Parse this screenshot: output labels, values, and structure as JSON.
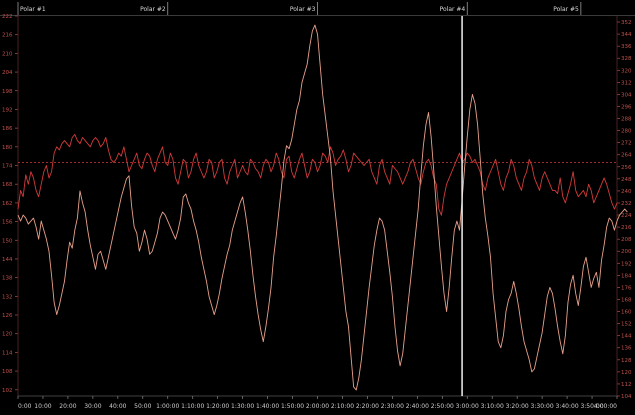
{
  "laps": [
    {
      "label": "Polar #1",
      "start_index": 0
    },
    {
      "label": "Polar #2",
      "start_index": 58
    },
    {
      "label": "Polar #3",
      "start_index": 116
    },
    {
      "label": "Polar #4",
      "start_index": 174
    },
    {
      "label": "Polar #5",
      "start_index": 218
    }
  ],
  "cursor": {
    "x_label": "2:50:00",
    "index": 172
  },
  "chart_data": {
    "type": "line",
    "x_labels": [
      "0:00",
      "10:00",
      "20:00",
      "30:00",
      "40:00",
      "50:00",
      "1:00:00",
      "1:10:00",
      "1:20:00",
      "1:30:00",
      "1:40:00",
      "1:50:00",
      "2:00:00",
      "2:10:00",
      "2:20:00",
      "2:30:00",
      "2:40:00",
      "2:50:00",
      "3:00:00",
      "3:10:00",
      "3:20:00",
      "3:30:00",
      "3:40:00",
      "3:50:00",
      "4:00:00"
    ],
    "left_axis": {
      "ylim": [
        100,
        222
      ],
      "ticks": [
        102,
        108,
        114,
        120,
        126,
        132,
        138,
        144,
        150,
        156,
        162,
        168,
        174,
        180,
        186,
        192,
        198,
        204,
        210,
        216,
        222
      ],
      "color": "#c0504a"
    },
    "right_axis": {
      "ylim": [
        104,
        356
      ],
      "ticks": [
        104,
        112,
        120,
        128,
        136,
        144,
        152,
        160,
        168,
        176,
        184,
        192,
        200,
        208,
        216,
        224,
        232,
        240,
        248,
        256,
        264,
        272,
        280,
        288,
        296,
        304,
        312,
        320,
        328,
        336,
        344,
        352
      ],
      "color": "#c0504a"
    },
    "reference_line": {
      "axis": "left",
      "y": 175
    },
    "series": [
      {
        "axis": "left",
        "color": "#d23a3a",
        "values": [
          160,
          166,
          164,
          171,
          168,
          172,
          170,
          166,
          164,
          168,
          172,
          174,
          170,
          172,
          178,
          180,
          179,
          181,
          182,
          181,
          180,
          183,
          184,
          182,
          181,
          183,
          182,
          181,
          180,
          182,
          183,
          182,
          180,
          181,
          183,
          179,
          176,
          175,
          176,
          178,
          177,
          180,
          176,
          172,
          174,
          176,
          178,
          174,
          173,
          176,
          178,
          177,
          174,
          172,
          176,
          178,
          180,
          175,
          174,
          178,
          176,
          170,
          168,
          172,
          176,
          175,
          170,
          172,
          176,
          178,
          174,
          172,
          170,
          172,
          176,
          175,
          170,
          172,
          175,
          176,
          170,
          168,
          172,
          174,
          176,
          170,
          172,
          174,
          172,
          171,
          176,
          175,
          173,
          172,
          170,
          174,
          176,
          175,
          172,
          174,
          178,
          176,
          172,
          170,
          176,
          177,
          172,
          170,
          173,
          176,
          178,
          174,
          170,
          172,
          176,
          175,
          172,
          174,
          178,
          177,
          175,
          180,
          178,
          174,
          176,
          177,
          179,
          176,
          172,
          174,
          178,
          177,
          176,
          175,
          174,
          175,
          176,
          172,
          170,
          168,
          174,
          176,
          172,
          170,
          168,
          174,
          173,
          172,
          170,
          168,
          170,
          172,
          175,
          176,
          173,
          170,
          168,
          172,
          175,
          176,
          174,
          170,
          168,
          160,
          158,
          164,
          168,
          170,
          172,
          174,
          176,
          178,
          175,
          176,
          178,
          177,
          175,
          176,
          174,
          172,
          168,
          166,
          170,
          172,
          174,
          176,
          172,
          168,
          166,
          170,
          172,
          176,
          174,
          170,
          168,
          166,
          170,
          172,
          176,
          174,
          170,
          168,
          166,
          170,
          172,
          170,
          168,
          166,
          166,
          165,
          170,
          164,
          162,
          165,
          168,
          172,
          166,
          164,
          165,
          166,
          164,
          168,
          166,
          162,
          164,
          166,
          168,
          170,
          168,
          165,
          162,
          160,
          162
        ]
      },
      {
        "axis": "right",
        "color": "#e8a08a",
        "values": [
          224,
          220,
          224,
          222,
          218,
          220,
          222,
          216,
          208,
          220,
          214,
          208,
          200,
          184,
          166,
          158,
          164,
          172,
          180,
          194,
          206,
          202,
          214,
          222,
          240,
          232,
          226,
          214,
          204,
          196,
          188,
          198,
          200,
          194,
          188,
          196,
          204,
          212,
          220,
          228,
          236,
          242,
          248,
          250,
          230,
          216,
          212,
          200,
          206,
          214,
          208,
          198,
          200,
          206,
          212,
          222,
          226,
          224,
          220,
          216,
          212,
          208,
          214,
          222,
          236,
          238,
          232,
          228,
          220,
          214,
          206,
          196,
          188,
          180,
          170,
          164,
          158,
          164,
          172,
          182,
          190,
          198,
          204,
          214,
          220,
          226,
          232,
          236,
          226,
          214,
          200,
          184,
          170,
          158,
          148,
          140,
          150,
          162,
          176,
          196,
          210,
          226,
          242,
          260,
          270,
          268,
          274,
          284,
          294,
          300,
          312,
          318,
          324,
          336,
          346,
          350,
          344,
          324,
          304,
          290,
          276,
          262,
          240,
          224,
          208,
          192,
          176,
          160,
          150,
          130,
          110,
          108,
          116,
          128,
          144,
          160,
          176,
          190,
          204,
          214,
          222,
          220,
          214,
          200,
          186,
          170,
          150,
          134,
          124,
          132,
          148,
          164,
          180,
          196,
          212,
          228,
          250,
          270,
          284,
          292,
          276,
          254,
          230,
          210,
          190,
          172,
          160,
          176,
          196,
          214,
          220,
          214,
          234,
          256,
          276,
          294,
          304,
          298,
          284,
          262,
          238,
          222,
          210,
          196,
          172,
          156,
          140,
          136,
          144,
          160,
          168,
          172,
          180,
          172,
          162,
          150,
          140,
          134,
          128,
          120,
          122,
          130,
          138,
          146,
          158,
          170,
          176,
          172,
          162,
          150,
          140,
          132,
          144,
          166,
          178,
          184,
          172,
          164,
          176,
          190,
          196,
          186,
          176,
          182,
          186,
          176,
          194,
          204,
          216,
          222,
          220,
          214,
          220,
          224,
          226,
          228,
          226
        ]
      }
    ]
  }
}
